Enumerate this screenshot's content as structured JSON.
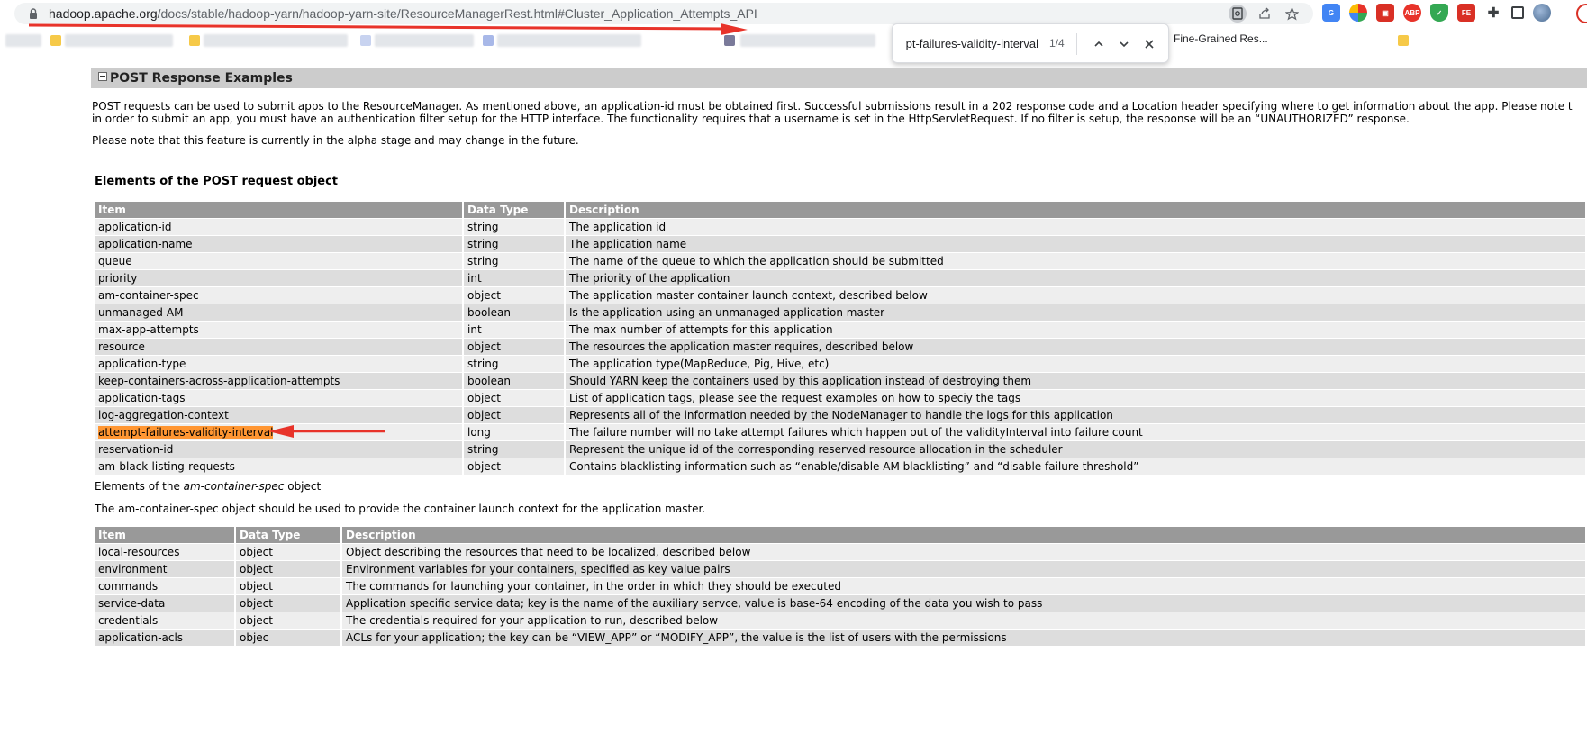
{
  "browser": {
    "url_host": "hadoop.apache.org",
    "url_path": "/docs/stable/hadoop-yarn/hadoop-yarn-site/ResourceManagerRest.html#Cluster_Application_Attempts_API",
    "bookmark_visible_label": "Fine-Grained Res...",
    "extension_labels": [
      "ABP",
      "FE"
    ],
    "find": {
      "query": "attempt-failures-validity-interval",
      "count": "1/4"
    },
    "accent_colors": {
      "annotation_arrow": "#e8332a",
      "find_highlight": "#ff9632"
    }
  },
  "section": {
    "title": "POST Response Examples",
    "para1_line1": "POST requests can be used to submit apps to the ResourceManager. As mentioned above, an application-id must be obtained first. Successful submissions result in a 202 response code and a Location header specifying where to get information about the app. Please note t",
    "para1_line2": "in order to submit an app, you must have an authentication filter setup for the HTTP interface. The functionality requires that a username is set in the HttpServletRequest. If no filter is setup, the response will be an “UNAUTHORIZED” response.",
    "para2": "Please note that this feature is currently in the alpha stage and may change in the future."
  },
  "table1": {
    "title": "Elements of the POST request object",
    "headers": [
      "Item",
      "Data Type",
      "Description"
    ],
    "rows": [
      [
        "application-id",
        "string",
        "The application id"
      ],
      [
        "application-name",
        "string",
        "The application name"
      ],
      [
        "queue",
        "string",
        "The name of the queue to which the application should be submitted"
      ],
      [
        "priority",
        "int",
        "The priority of the application"
      ],
      [
        "am-container-spec",
        "object",
        "The application master container launch context, described below"
      ],
      [
        "unmanaged-AM",
        "boolean",
        "Is the application using an unmanaged application master"
      ],
      [
        "max-app-attempts",
        "int",
        "The max number of attempts for this application"
      ],
      [
        "resource",
        "object",
        "The resources the application master requires, described below"
      ],
      [
        "application-type",
        "string",
        "The application type(MapReduce, Pig, Hive, etc)"
      ],
      [
        "keep-containers-across-application-attempts",
        "boolean",
        "Should YARN keep the containers used by this application instead of destroying them"
      ],
      [
        "application-tags",
        "object",
        "List of application tags, please see the request examples on how to speciy the tags"
      ],
      [
        "log-aggregation-context",
        "object",
        "Represents all of the information needed by the NodeManager to handle the logs for this application"
      ],
      [
        "attempt-failures-validity-interval",
        "long",
        "The failure number will no take attempt failures which happen out of the validityInterval into failure count"
      ],
      [
        "reservation-id",
        "string",
        "Represent the unique id of the corresponding reserved resource allocation in the scheduler"
      ],
      [
        "am-black-listing-requests",
        "object",
        "Contains blacklisting information such as “enable/disable AM blacklisting” and “disable failure threshold”"
      ]
    ]
  },
  "section2": {
    "title_prefix": "Elements of the ",
    "title_em": "am-container-spec",
    "title_suffix": " object",
    "intro": "The am-container-spec object should be used to provide the container launch context for the application master."
  },
  "table2": {
    "headers": [
      "Item",
      "Data Type",
      "Description"
    ],
    "rows": [
      [
        "local-resources",
        "object",
        "Object describing the resources that need to be localized, described below"
      ],
      [
        "environment",
        "object",
        "Environment variables for your containers, specified as key value pairs"
      ],
      [
        "commands",
        "object",
        "The commands for launching your container, in the order in which they should be executed"
      ],
      [
        "service-data",
        "object",
        "Application specific service data; key is the name of the auxiliary servce, value is base-64 encoding of the data you wish to pass"
      ],
      [
        "credentials",
        "object",
        "The credentials required for your application to run, described below"
      ],
      [
        "application-acls",
        "objec",
        "ACLs for your application; the key can be “VIEW_APP” or “MODIFY_APP”, the value is the list of users with the permissions"
      ]
    ]
  }
}
